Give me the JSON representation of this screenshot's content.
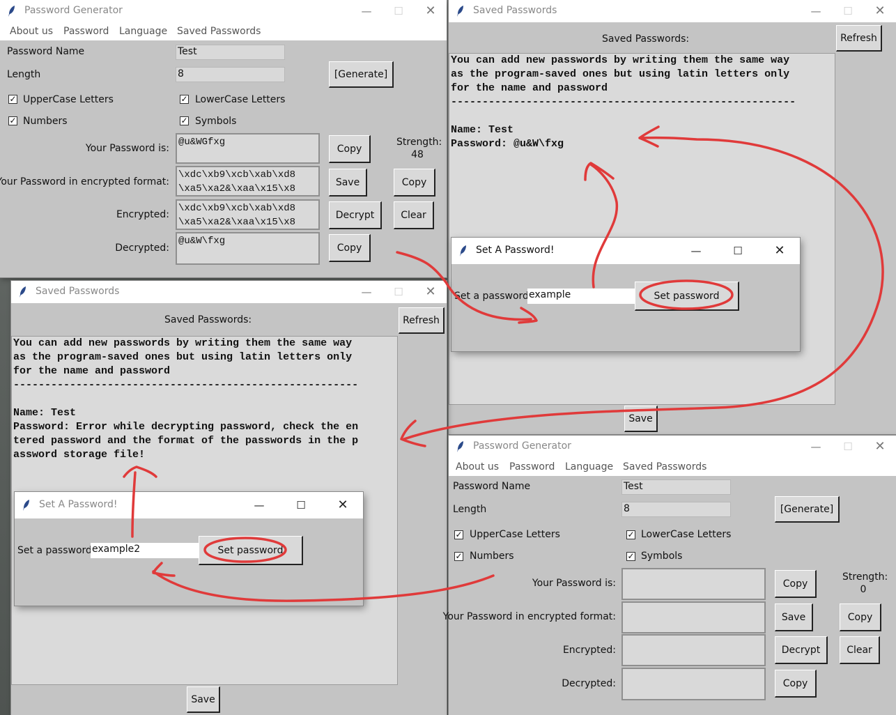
{
  "gen1": {
    "title": "Password Generator",
    "menu": [
      "About us",
      "Password",
      "Language",
      "Saved Passwords"
    ],
    "labels": {
      "password_name": "Password Name",
      "length": "Length",
      "uppercase": "UpperCase Letters",
      "lowercase": "LowerCase Letters",
      "numbers": "Numbers",
      "symbols": "Symbols",
      "your_password": "Your Password is:",
      "encrypted_format": "Your Password in encrypted format:",
      "encrypted": "Encrypted:",
      "decrypted": "Decrypted:",
      "strength": "Strength:"
    },
    "values": {
      "password_name": "Test",
      "length": "8",
      "password": "@u&WGfxg",
      "encrypted_format": "\\xdc\\xb9\\xcb\\xab\\xd8\n\\xa5\\xa2&\\xaa\\x15\\x8",
      "encrypted": "\\xdc\\xb9\\xcb\\xab\\xd8\n\\xa5\\xa2&\\xaa\\x15\\x8",
      "decrypted": "@u&W\\fxg",
      "strength": "48"
    },
    "buttons": {
      "generate": "[Generate]",
      "copy": "Copy",
      "save": "Save",
      "copy2": "Copy",
      "decrypt": "Decrypt",
      "clear": "Clear",
      "copy3": "Copy"
    }
  },
  "saved1": {
    "title": "Saved Passwords",
    "header": "Saved Passwords:",
    "refresh": "Refresh",
    "save": "Save",
    "content": "You can add new passwords by writing them the same way\nas the program-saved ones but using latin letters only\nfor the name and password\n-------------------------------------------------------\n\nName: Test\nPassword: @u&W\\fxg"
  },
  "dialog1": {
    "title": "Set A Password!",
    "label": "Set a password:",
    "value": "example",
    "button": "Set password"
  },
  "saved2": {
    "title": "Saved Passwords",
    "header": "Saved Passwords:",
    "refresh": "Refresh",
    "save": "Save",
    "content": "You can add new passwords by writing them the same way\nas the program-saved ones but using latin letters only\nfor the name and password\n-------------------------------------------------------\n\nName: Test\nPassword: Error while decrypting password, check the en\ntered password and the format of the passwords in the p\nassword storage file!"
  },
  "dialog2": {
    "title": "Set A Password!",
    "label": "Set a password:",
    "value": "example2",
    "button": "Set password"
  },
  "gen2": {
    "title": "Password Generator",
    "menu": [
      "About us",
      "Password",
      "Language",
      "Saved Passwords"
    ],
    "labels": {
      "password_name": "Password Name",
      "length": "Length",
      "uppercase": "UpperCase Letters",
      "lowercase": "LowerCase Letters",
      "numbers": "Numbers",
      "symbols": "Symbols",
      "your_password": "Your Password is:",
      "encrypted_format": "Your Password in encrypted format:",
      "encrypted": "Encrypted:",
      "decrypted": "Decrypted:",
      "strength": "Strength:"
    },
    "values": {
      "password_name": "Test",
      "length": "8",
      "password": "",
      "encrypted_format": "",
      "encrypted": "",
      "decrypted": "",
      "strength": "0"
    },
    "buttons": {
      "generate": "[Generate]",
      "copy": "Copy",
      "save": "Save",
      "copy2": "Copy",
      "decrypt": "Decrypt",
      "clear": "Clear",
      "copy3": "Copy"
    }
  },
  "colors": {
    "annotation": "#e03a3a",
    "window_bg": "#c4c4c4",
    "field_bg": "#d9d9d9"
  }
}
